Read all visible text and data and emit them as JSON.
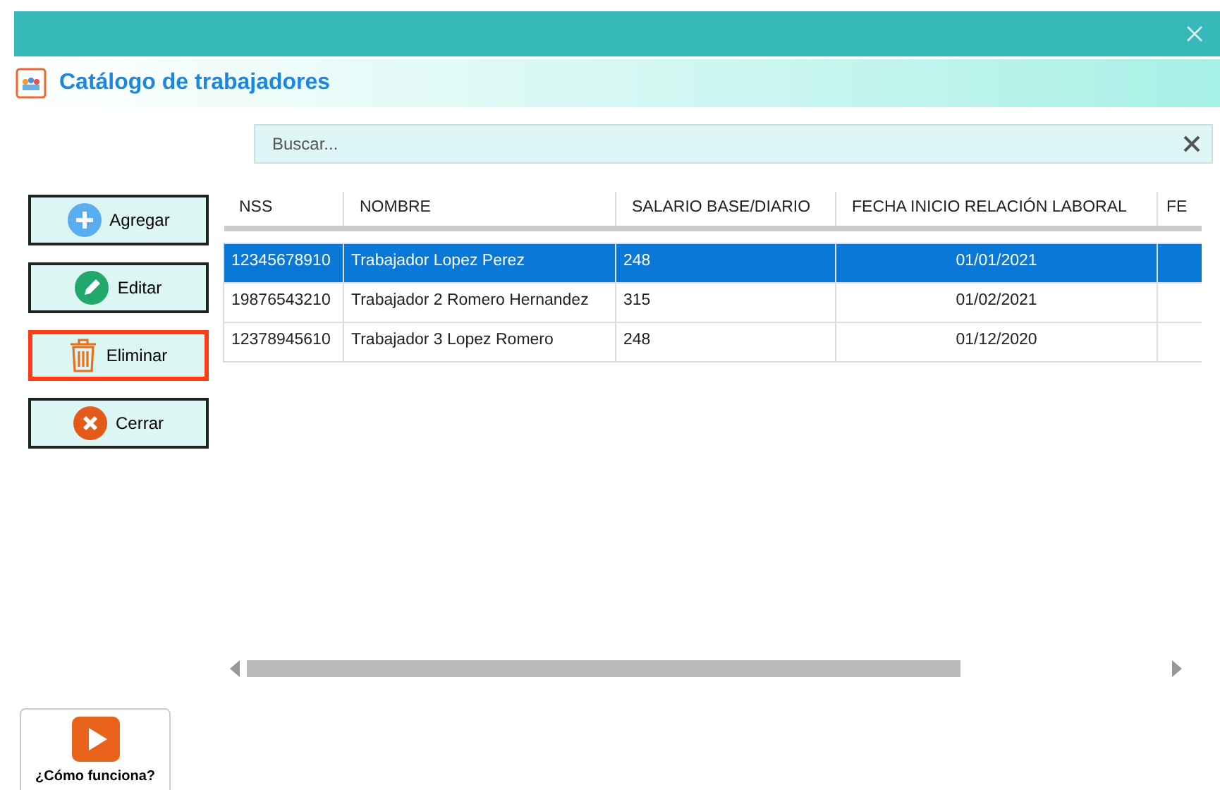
{
  "window": {
    "title": "Catálogo de trabajadores"
  },
  "search": {
    "placeholder": "Buscar..."
  },
  "buttons": [
    {
      "label": "Agregar",
      "kind": "add",
      "focused": false
    },
    {
      "label": "Editar",
      "kind": "edit",
      "focused": false
    },
    {
      "label": "Eliminar",
      "kind": "delete",
      "focused": true
    },
    {
      "label": "Cerrar",
      "kind": "close",
      "focused": false
    }
  ],
  "table": {
    "columns": [
      "NSS",
      "NOMBRE",
      "SALARIO BASE/DIARIO",
      "FECHA INICIO RELACIÓN LABORAL",
      "FE"
    ],
    "rows": [
      {
        "cells": [
          "12345678910",
          "Trabajador Lopez Perez",
          "248",
          "01/01/2021",
          ""
        ],
        "selected": true
      },
      {
        "cells": [
          "19876543210",
          "Trabajador 2 Romero Hernandez",
          "315",
          "01/02/2021",
          ""
        ],
        "selected": false
      },
      {
        "cells": [
          "12378945610",
          "Trabajador 3 Lopez Romero",
          "248",
          "01/12/2020",
          ""
        ],
        "selected": false
      }
    ]
  },
  "help_button": {
    "label": "¿Cómo funciona?"
  }
}
